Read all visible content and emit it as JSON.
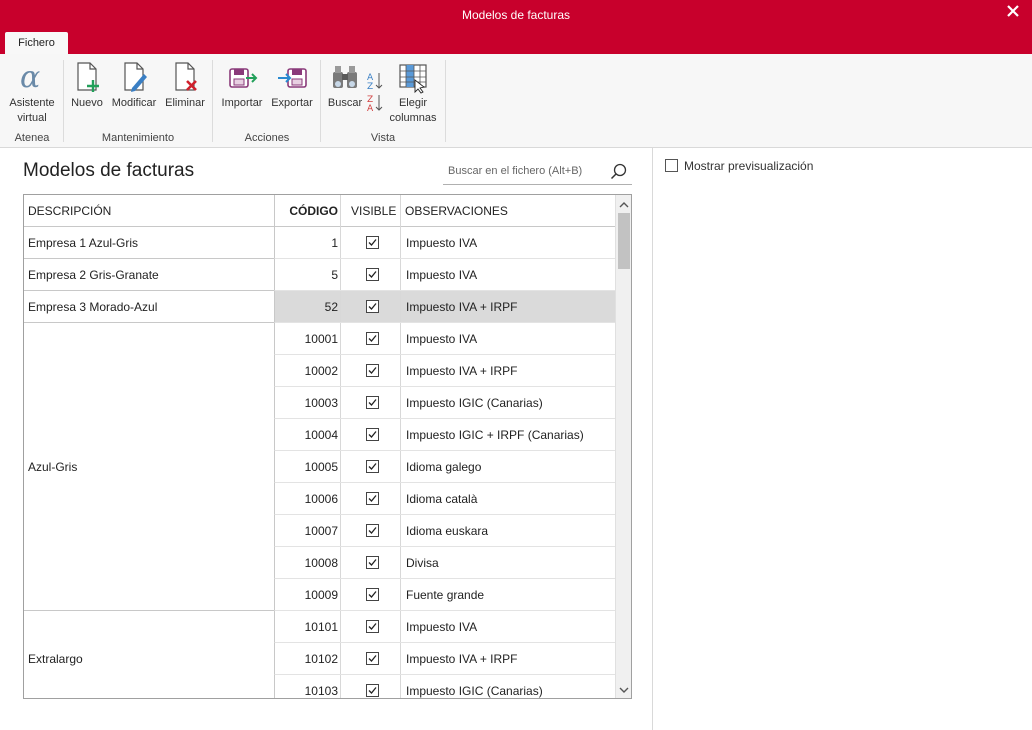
{
  "window": {
    "title": "Modelos de facturas"
  },
  "tabs": [
    {
      "label": "Fichero"
    }
  ],
  "ribbon": {
    "groups": [
      {
        "label": "Atenea"
      },
      {
        "label": "Mantenimiento"
      },
      {
        "label": "Acciones"
      },
      {
        "label": "Vista"
      }
    ],
    "buttons": {
      "asistente": "Asistente\nvirtual",
      "nuevo": "Nuevo",
      "modificar": "Modificar",
      "eliminar": "Eliminar",
      "importar": "Importar",
      "exportar": "Exportar",
      "buscar": "Buscar",
      "elegir": "Elegir\ncolumnas"
    }
  },
  "main": {
    "title": "Modelos de facturas",
    "search_placeholder": "Buscar en el fichero (Alt+B)",
    "preview_label": "Mostrar previsualización"
  },
  "table": {
    "headers": {
      "descripcion": "DESCRIPCIÓN",
      "codigo": "CÓDIGO",
      "visible": "VISIBLE",
      "observaciones": "OBSERVACIONES"
    },
    "groups": [
      {
        "label": "Empresa 1 Azul-Gris",
        "rows": 1
      },
      {
        "label": "Empresa 2 Gris-Granate",
        "rows": 1
      },
      {
        "label": "Empresa 3 Morado-Azul",
        "rows": 1
      },
      {
        "label": "Azul-Gris",
        "rows": 9
      },
      {
        "label": "Extralargo",
        "rows": 3
      }
    ],
    "rows": [
      {
        "code": "1",
        "visible": true,
        "obs": "Impuesto IVA",
        "selected": false
      },
      {
        "code": "5",
        "visible": true,
        "obs": "Impuesto IVA",
        "selected": false
      },
      {
        "code": "52",
        "visible": true,
        "obs": "Impuesto IVA + IRPF",
        "selected": true
      },
      {
        "code": "10001",
        "visible": true,
        "obs": "Impuesto IVA",
        "selected": false
      },
      {
        "code": "10002",
        "visible": true,
        "obs": "Impuesto IVA + IRPF",
        "selected": false
      },
      {
        "code": "10003",
        "visible": true,
        "obs": "Impuesto IGIC (Canarias)",
        "selected": false
      },
      {
        "code": "10004",
        "visible": true,
        "obs": "Impuesto IGIC + IRPF (Canarias)",
        "selected": false
      },
      {
        "code": "10005",
        "visible": true,
        "obs": "Idioma galego",
        "selected": false
      },
      {
        "code": "10006",
        "visible": true,
        "obs": "Idioma català",
        "selected": false
      },
      {
        "code": "10007",
        "visible": true,
        "obs": "Idioma euskara",
        "selected": false
      },
      {
        "code": "10008",
        "visible": true,
        "obs": "Divisa",
        "selected": false
      },
      {
        "code": "10009",
        "visible": true,
        "obs": "Fuente grande",
        "selected": false
      },
      {
        "code": "10101",
        "visible": true,
        "obs": "Impuesto IVA",
        "selected": false
      },
      {
        "code": "10102",
        "visible": true,
        "obs": "Impuesto IVA + IRPF",
        "selected": false
      },
      {
        "code": "10103",
        "visible": true,
        "obs": "Impuesto IGIC (Canarias)",
        "selected": false
      }
    ]
  },
  "colors": {
    "brand": "#c8002c",
    "selected_row": "#dadada"
  },
  "icons": [
    "close-icon",
    "alpha-icon",
    "new-doc-icon",
    "edit-doc-icon",
    "delete-doc-icon",
    "import-icon",
    "export-icon",
    "binoculars-icon",
    "sort-icon",
    "columns-icon",
    "search-icon",
    "checkbox-icon",
    "scroll-up-icon",
    "scroll-down-icon"
  ]
}
